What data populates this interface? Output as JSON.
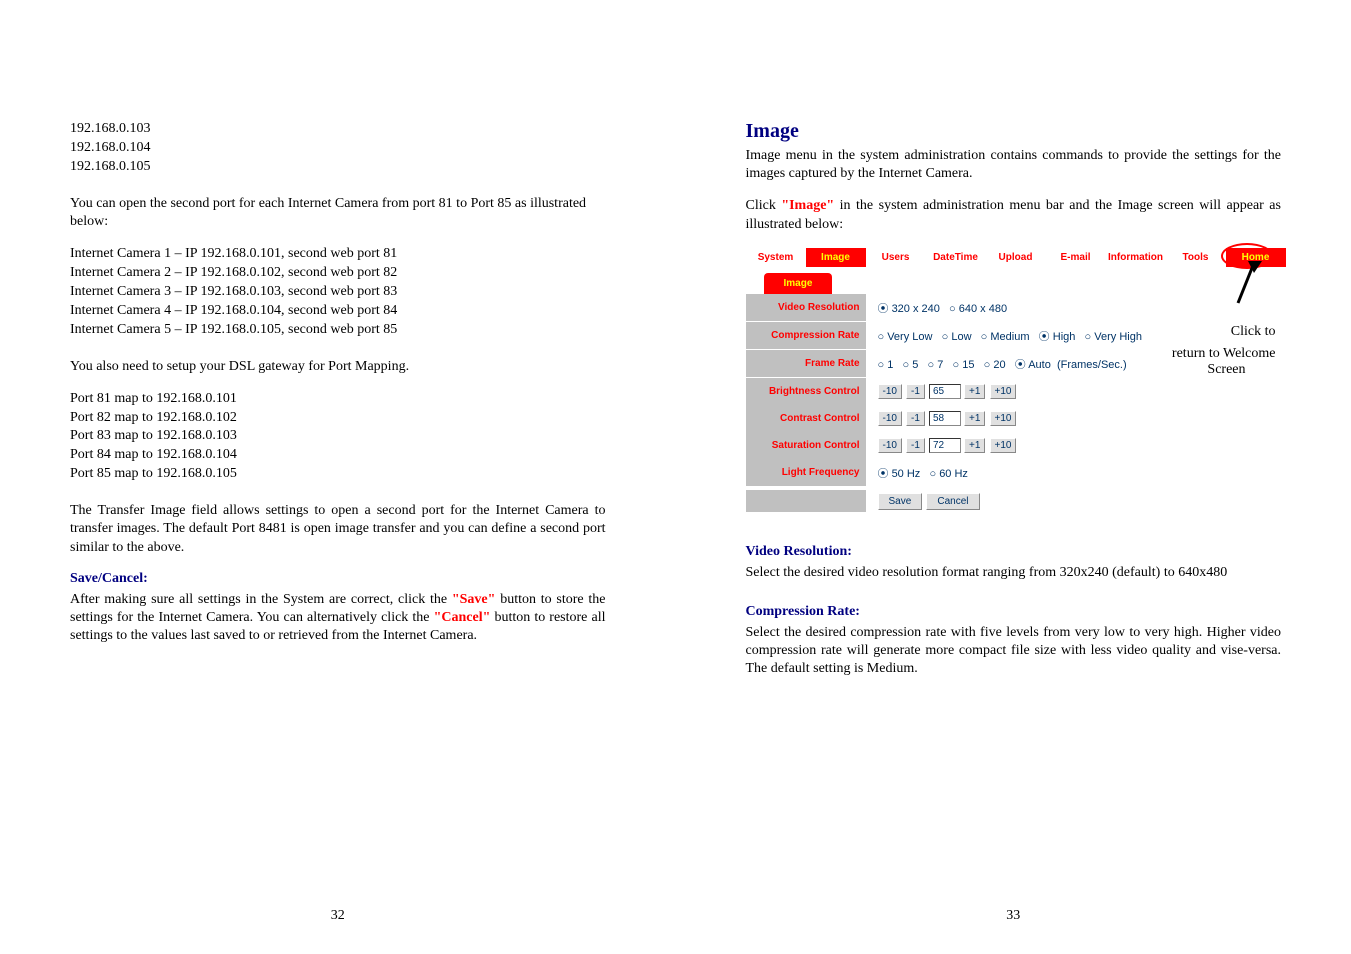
{
  "left": {
    "ips": [
      "192.168.0.103",
      "192.168.0.104",
      "192.168.0.105"
    ],
    "open_port_text": "You can open the second port for each Internet Camera from port 81 to Port 85 as illustrated below:",
    "cameras": [
      "Internet Camera 1 – IP 192.168.0.101, second web port 81",
      "Internet Camera 2 – IP 192.168.0.102, second web port 82",
      "Internet Camera 3 – IP 192.168.0.103, second web port 83",
      "Internet Camera 4 – IP 192.168.0.104, second web port 84",
      "Internet Camera 5 – IP 192.168.0.105, second web port 85"
    ],
    "dsl_text": "You also need to setup your DSL gateway for Port Mapping.",
    "port_maps": [
      "Port 81 map to 192.168.0.101",
      "Port 82 map to 192.168.0.102",
      "Port 83 map to 192.168.0.103",
      "Port 84 map to 192.168.0.104",
      "Port 85 map to 192.168.0.105"
    ],
    "transfer_text": "The Transfer Image field allows settings to open a second port for the Internet Camera to transfer images.  The default Port 8481 is open image transfer and you can define a second port similar to the above.",
    "save_heading": "Save/Cancel:",
    "save_para_1": "After making sure all settings in the System are correct, click the ",
    "save_word": "\"Save\"",
    "save_para_2": " button to store the settings for the Internet Camera.  You can alternatively click the ",
    "cancel_word": "\"Cancel\"",
    "save_para_3": " button to restore all settings to the values last saved to or retrieved from the Internet Camera.",
    "page_num": "32"
  },
  "right": {
    "heading": "Image",
    "intro": "Image menu in the system administration contains commands to provide the settings for the images captured by the Internet Camera.",
    "click_1": "Click ",
    "click_word": "\"Image\"",
    "click_2": " in the system administration menu bar and the Image screen will appear as illustrated below:",
    "menu": [
      "System",
      "Image",
      "Users",
      "DateTime",
      "Upload",
      "E-mail",
      "Information",
      "Tools",
      "Home"
    ],
    "tab_label": "Image",
    "rows": {
      "video_res": {
        "label": "Video Resolution",
        "opt1": "320 x 240",
        "opt2": "640 x 480"
      },
      "comp_rate": {
        "label": "Compression Rate",
        "opts": [
          "Very Low",
          "Low",
          "Medium",
          "High",
          "Very High"
        ]
      },
      "frame_rate": {
        "label": "Frame Rate",
        "opts": [
          "1",
          "5",
          "7",
          "15",
          "20",
          "Auto"
        ],
        "suffix": "(Frames/Sec.)"
      },
      "brightness": {
        "label": "Brightness Control",
        "val": "65"
      },
      "contrast": {
        "label": "Contrast Control",
        "val": "58"
      },
      "saturation": {
        "label": "Saturation Control",
        "val": "72"
      },
      "light": {
        "label": "Light Frequency",
        "opt1": "50 Hz",
        "opt2": "60 Hz"
      },
      "save": "Save",
      "cancel": "Cancel"
    },
    "side_note": {
      "l1": "Click          to",
      "l2": "return to Welcome",
      "l3": "Screen"
    },
    "vr_heading": "Video Resolution:",
    "vr_text": "Select the desired video resolution format ranging from 320x240 (default) to 640x480",
    "cr_heading": "Compression Rate:",
    "cr_text": "Select the desired compression rate with five levels from very low to very high.  Higher video compression rate will generate more compact file size with less video quality and vise-versa.  The default setting is Medium.",
    "page_num": "33",
    "btn": {
      "m10": "-10",
      "m1": "-1",
      "p1": "+1",
      "p10": "+10"
    },
    "home_word": "\"Home\""
  }
}
